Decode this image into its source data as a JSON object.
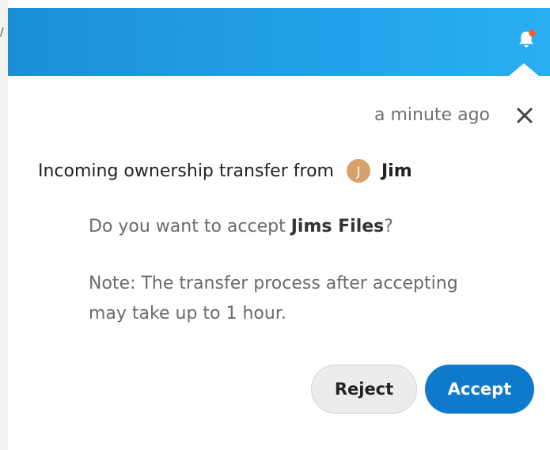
{
  "notification": {
    "timestamp": "a minute ago",
    "title_prefix": "Incoming ownership transfer from",
    "user": {
      "name": "Jim",
      "initial": "J",
      "avatar_color": "#d8a06b"
    },
    "question_prefix": "Do you want to accept ",
    "file_name": "Jims Files",
    "question_suffix": "?",
    "note_line1": "Note: The transfer process after accepting",
    "note_line2": "may take up to 1 hour.",
    "reject_label": "Reject",
    "accept_label": "Accept"
  },
  "header": {
    "bell_icon": "bell-icon",
    "unread_dot": true,
    "accent": "#1b8fd6"
  },
  "colors": {
    "accept_button": "#0f7acb",
    "unread_dot": "#ff5a1f"
  },
  "icons": {
    "close": "close-icon",
    "bell": "bell-icon"
  }
}
